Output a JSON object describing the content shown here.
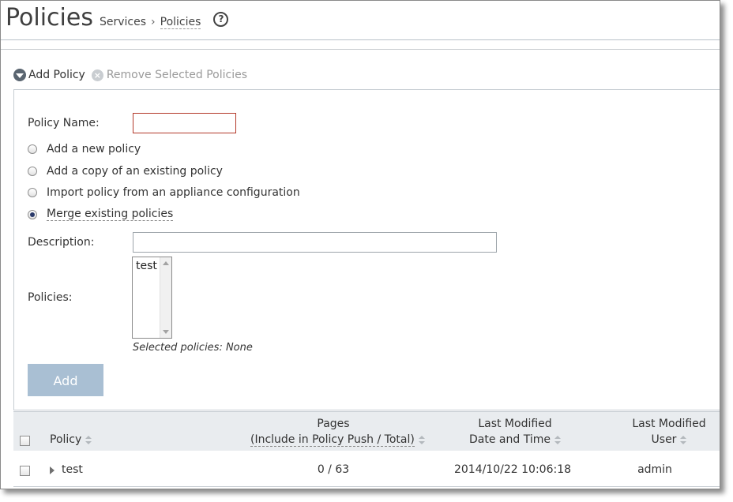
{
  "header": {
    "title": "Policies",
    "breadcrumb": [
      "Services",
      "Policies"
    ],
    "help_glyph": "?"
  },
  "toolbar": {
    "add_label": "Add Policy",
    "remove_label": "Remove Selected Policies"
  },
  "form": {
    "policy_name_label": "Policy Name:",
    "policy_name_value": "",
    "options": [
      {
        "label": "Add a new policy",
        "checked": false
      },
      {
        "label": "Add a copy of an existing policy",
        "checked": false
      },
      {
        "label": "Import policy from an appliance configuration",
        "checked": false
      },
      {
        "label": "Merge existing policies",
        "checked": true
      }
    ],
    "description_label": "Description:",
    "description_value": "",
    "policies_label": "Policies:",
    "policies_list": [
      "test"
    ],
    "selected_note": "Selected policies: None",
    "add_button": "Add"
  },
  "table": {
    "columns": {
      "policy": "Policy",
      "pages_line1": "Pages",
      "pages_line2": "(Include in Policy Push / Total)",
      "modified_line1": "Last Modified",
      "modified_line2": "Date and Time",
      "user_line1": "Last Modified",
      "user_line2": "User"
    },
    "rows": [
      {
        "policy": "test",
        "pages": "0 / 63",
        "modified": "2014/10/22 10:06:18",
        "user": "admin"
      }
    ]
  },
  "colors": {
    "accent_button": "#a9bfd3",
    "error_border": "#b33a2a",
    "table_header_bg": "#e9ecef"
  }
}
